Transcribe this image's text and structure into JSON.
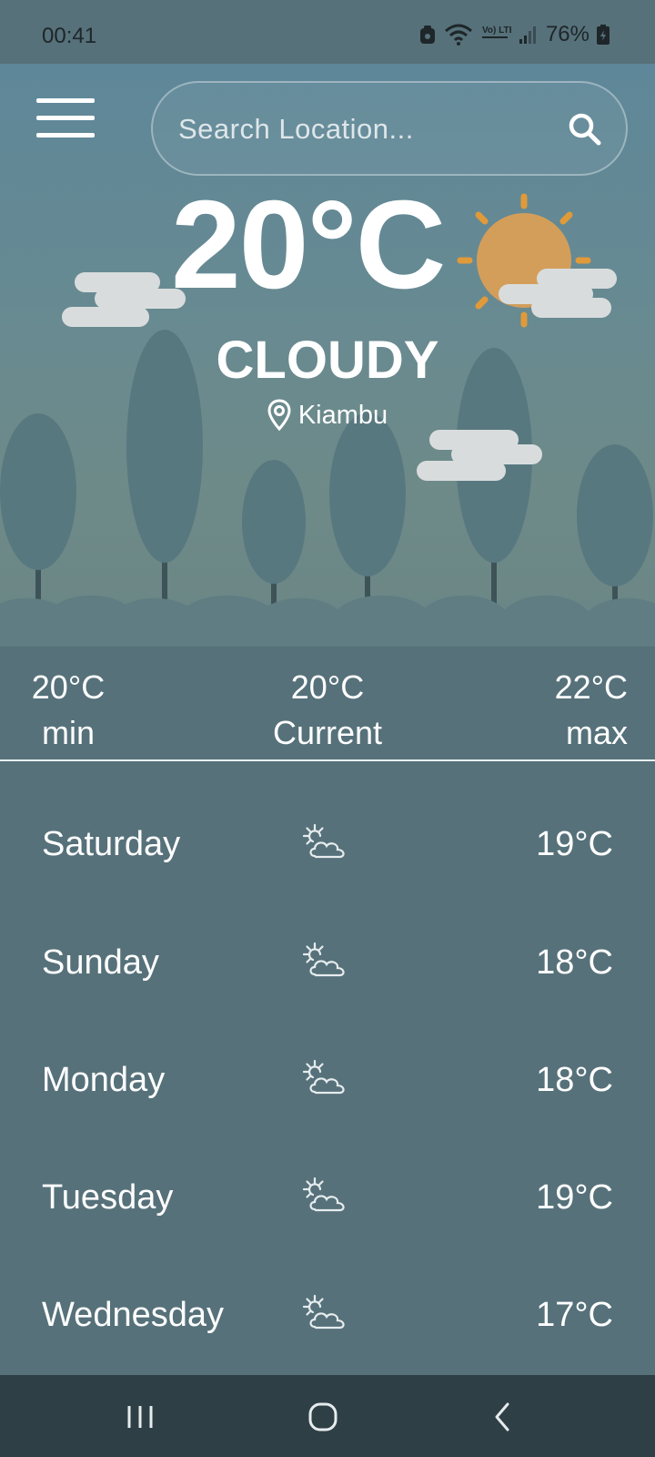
{
  "status_bar": {
    "time": "00:41",
    "network_label": "Vo) LTE1",
    "battery": "76%"
  },
  "search": {
    "placeholder": "Search Location..."
  },
  "weather": {
    "temperature": "20°C",
    "condition": "CLOUDY",
    "location": "Kiambu"
  },
  "stats": {
    "min_value": "20°C",
    "min_label": "min",
    "current_value": "20°C",
    "current_label": "Current",
    "max_value": "22°C",
    "max_label": "max"
  },
  "forecast": [
    {
      "day": "Saturday",
      "temp": "19°C",
      "icon": "sun-cloud-icon"
    },
    {
      "day": "Sunday",
      "temp": "18°C",
      "icon": "sun-cloud-icon"
    },
    {
      "day": "Monday",
      "temp": "18°C",
      "icon": "sun-cloud-icon"
    },
    {
      "day": "Tuesday",
      "temp": "19°C",
      "icon": "sun-cloud-icon"
    },
    {
      "day": "Wednesday",
      "temp": "17°C",
      "icon": "sun-cloud-icon"
    }
  ],
  "colors": {
    "background": "#56717A",
    "sky_top": "#5E8799",
    "sun": "#D39E5A",
    "sun_rays": "#E09A3A",
    "tree": "#587880",
    "nav_bar": "#2F3F46"
  },
  "nav": {
    "recents_icon": "recents-icon",
    "home_icon": "home-icon",
    "back_icon": "back-icon"
  }
}
